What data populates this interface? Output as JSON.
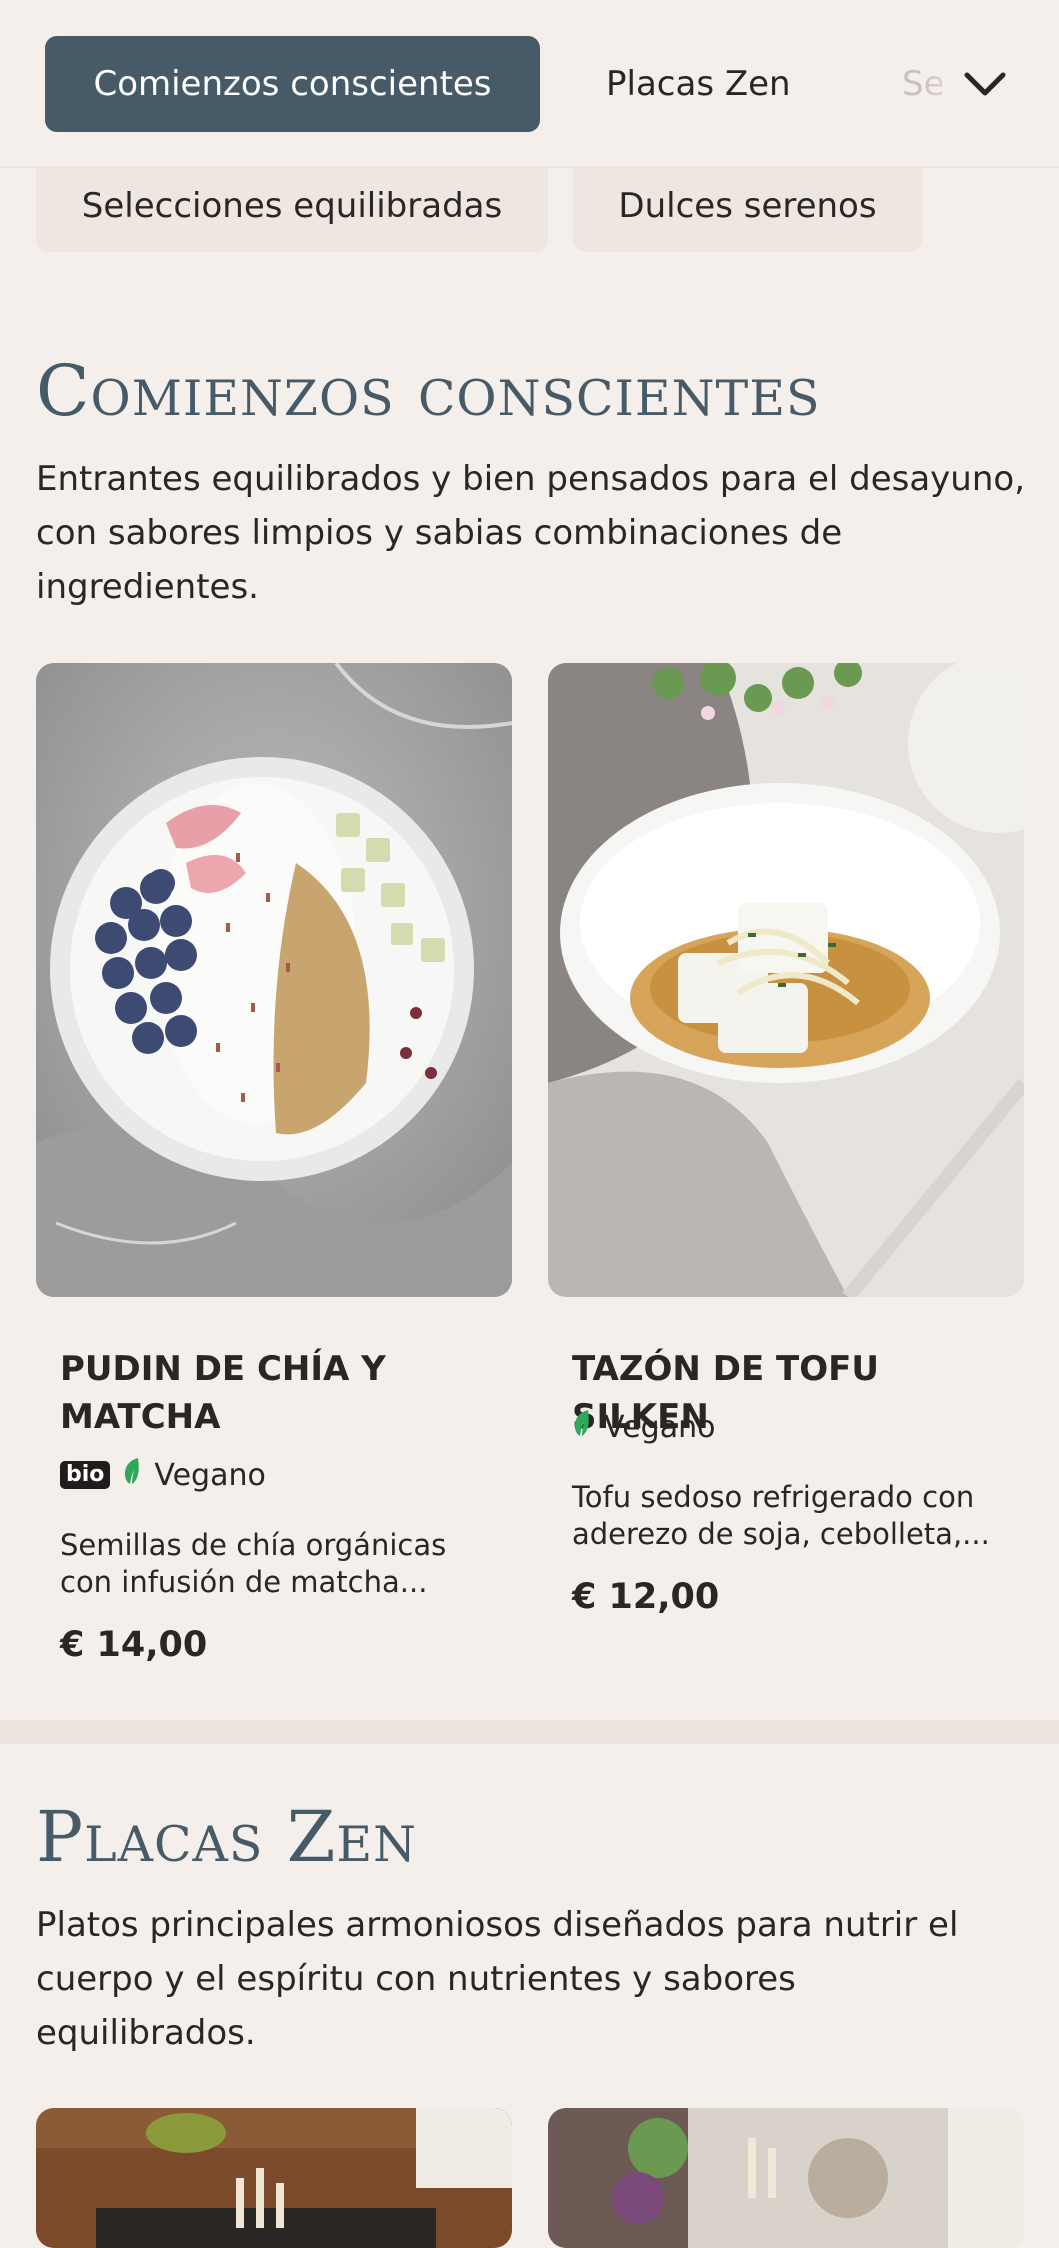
{
  "nav": {
    "active": "Comienzos conscientes",
    "second": "Placas Zen",
    "third_partial": "Se",
    "row2": [
      "Selecciones equilibradas",
      "Dulces serenos"
    ]
  },
  "sections": [
    {
      "title": "Comienzos conscientes",
      "description": "Entrantes equilibrados y bien pensados para el desayuno, con sabores limpios y sabias combinaciones de ingredientes.",
      "items": [
        {
          "name": "PUDIN DE CHÍA Y MATCHA",
          "bio": "bio",
          "tag": "Vegano",
          "description": "Semillas de chía orgánicas con infusión de matcha...",
          "price": "€ 14,00"
        },
        {
          "name": "TAZÓN DE TOFU SILKEN",
          "tag": "Vegano",
          "description": "Tofu sedoso refrigerado con aderezo de soja, cebolleta,...",
          "price": "€ 12,00"
        }
      ]
    },
    {
      "title": "Placas Zen",
      "description": "Platos principales armoniosos diseñados para nutrir el cuerpo y el espíritu con nutrientes y sabores equilibrados."
    }
  ],
  "icons": {
    "chevron": "chevron-down-icon",
    "leaf": "leaf-icon"
  },
  "colors": {
    "accent": "#465a67",
    "background": "#f5efeb",
    "leaf": "#2fa85a"
  }
}
